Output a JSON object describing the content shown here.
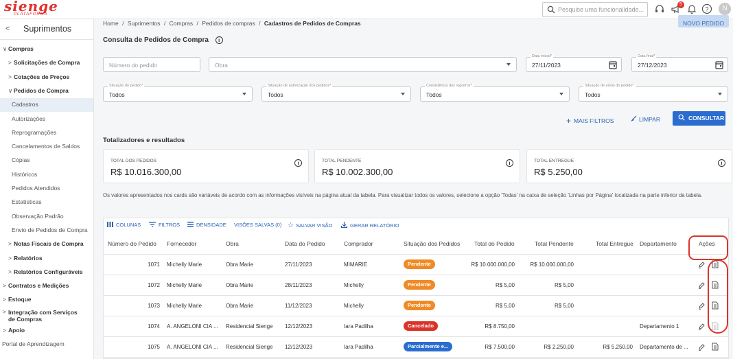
{
  "topbar": {
    "logo": "sienge",
    "logo_sub": "PLATAFORMA",
    "search_placeholder": "Pesquise uma funcionalidade...",
    "notif_count": "5",
    "avatar": "N"
  },
  "sidebar": {
    "back": "<",
    "title": "Suprimentos",
    "items": [
      {
        "label": "Compras",
        "chev": "∨",
        "bold": true
      },
      {
        "label": "Solicitações de Compra",
        "chev": ">",
        "bold": true
      },
      {
        "label": "Cotações de Preços",
        "chev": ">",
        "bold": true
      },
      {
        "label": "Pedidos de Compra",
        "chev": "∨",
        "bold": true
      },
      {
        "label": "Cadastros",
        "active": true
      },
      {
        "label": "Autorizações"
      },
      {
        "label": "Reprogramações"
      },
      {
        "label": "Cancelamentos de Saldos"
      },
      {
        "label": "Cópias"
      },
      {
        "label": "Históricos"
      },
      {
        "label": "Pedidos Atendidos"
      },
      {
        "label": "Estatísticas"
      },
      {
        "label": "Observação Padrão"
      },
      {
        "label": "Envio de Pedidos de Compra"
      },
      {
        "label": "Notas Fiscais de Compra",
        "chev": ">",
        "bold": true
      },
      {
        "label": "Relatórios",
        "chev": ">",
        "bold": true
      },
      {
        "label": "Relatórios Configuráveis",
        "chev": ">",
        "bold": true
      },
      {
        "label": "Contratos e Medições",
        "chev": ">",
        "bold": true
      },
      {
        "label": "Estoque",
        "chev": ">",
        "bold": true
      },
      {
        "label": "Integração com Serviços de Compras",
        "chev": ">",
        "bold": true
      },
      {
        "label": "Apoio",
        "chev": ">",
        "bold": true
      },
      {
        "label": "Portal de Aprendizagem"
      }
    ]
  },
  "breadcrumb": {
    "items": [
      "Home",
      "Suprimentos",
      "Compras",
      "Pedidos de compras"
    ],
    "current": "Cadastros de Pedidos de Compras",
    "sep": "/"
  },
  "novo_pedido": "NOVO PEDIDO",
  "page_title": "Consulta de Pedidos de Compra",
  "filters": {
    "numero_placeholder": "Número do pedido",
    "obra_placeholder": "Obra",
    "data_inicial_label": "Data inicial*",
    "data_inicial": "27/11/2023",
    "data_final_label": "Data final*",
    "data_final": "27/12/2023",
    "situacao_pedido_label": "Situação do pedido*",
    "situacao_pedido": "Todos",
    "situacao_aut_label": "Situação de autorização dos pedidos*",
    "situacao_aut": "Todos",
    "consistencia_label": "Consistência dos registros*",
    "consistencia": "Todos",
    "situacao_envio_label": "Situação de envio do pedido*",
    "situacao_envio": "Todos"
  },
  "actions": {
    "mais_filtros": "MAIS FILTROS",
    "limpar": "LIMPAR",
    "consultar": "CONSULTAR"
  },
  "totalizadores": {
    "title": "Totalizadores e resultados",
    "cards": [
      {
        "label": "TOTAL DOS PEDIDOS",
        "value": "R$ 10.016.300,00"
      },
      {
        "label": "TOTAL PENDENTE",
        "value": "R$ 10.002.300,00"
      },
      {
        "label": "TOTAL ENTREGUE",
        "value": "R$ 5.250,00"
      }
    ],
    "note": "Os valores apresentados nos cards são variáveis de acordo com as informações visíveis na página atual da tabela. Para visualizar todos os valores, selecione a opção 'Todas' na caixa de seleção 'Linhas por Página' localizada na parte inferior da tabela."
  },
  "toolbar": {
    "colunas": "COLUNAS",
    "filtros": "FILTROS",
    "densidade": "DENSIDADE",
    "visoes": "VISÕES SALVAS (0)",
    "salvar": "SALVAR VISÃO",
    "gerar": "GERAR RELATÓRIO"
  },
  "columns": [
    "Número do Pedido",
    "Fornecedor",
    "Obra",
    "Data do Pedido",
    "Comprador",
    "Situação dos Pedidos",
    "Total do Pedido",
    "Total Pendente",
    "Total Entregue",
    "Departamento",
    "Ações"
  ],
  "rows": [
    {
      "numero": "1071",
      "fornecedor": "Michelly Marie",
      "obra": "Obra Marie",
      "data": "27/11/2023",
      "comprador": "MIMARIE",
      "situacao": "Pendente",
      "status_color": "#f08a24",
      "total": "R$ 10.000.000,00",
      "pendente": "R$ 10.000.000,00",
      "entregue": "",
      "depto": ""
    },
    {
      "numero": "1072",
      "fornecedor": "Michelly Marie",
      "obra": "Obra Marie",
      "data": "28/11/2023",
      "comprador": "Michelly",
      "situacao": "Pendente",
      "status_color": "#f08a24",
      "total": "R$ 5,00",
      "pendente": "R$ 5,00",
      "entregue": "",
      "depto": ""
    },
    {
      "numero": "1073",
      "fornecedor": "Michelly Marie",
      "obra": "Obra Marie",
      "data": "11/12/2023",
      "comprador": "Michelly",
      "situacao": "Pendente",
      "status_color": "#f08a24",
      "total": "R$ 5,00",
      "pendente": "R$ 5,00",
      "entregue": "",
      "depto": ""
    },
    {
      "numero": "1074",
      "fornecedor": "A. ANGELONI CIA ...",
      "obra": "Residencial Sienge",
      "data": "12/12/2023",
      "comprador": "Iara Padilha",
      "situacao": "Cancelado",
      "status_color": "#d9342b",
      "total": "R$ 8.750,00",
      "pendente": "",
      "entregue": "",
      "depto": "Departamento 1"
    },
    {
      "numero": "1075",
      "fornecedor": "A. ANGELONI CIA ...",
      "obra": "Residencial Sienge",
      "data": "12/12/2023",
      "comprador": "Iara Padilha",
      "situacao": "Parcialmente e...",
      "status_color": "#2a6ccf",
      "total": "R$ 7.500,00",
      "pendente": "R$ 2.250,00",
      "entregue": "R$ 5.250,00",
      "depto": "Departamento de ..."
    }
  ],
  "colors": {
    "accent": "#2a6ccf",
    "brand": "#e0302f",
    "annotation": "#d9342b"
  }
}
